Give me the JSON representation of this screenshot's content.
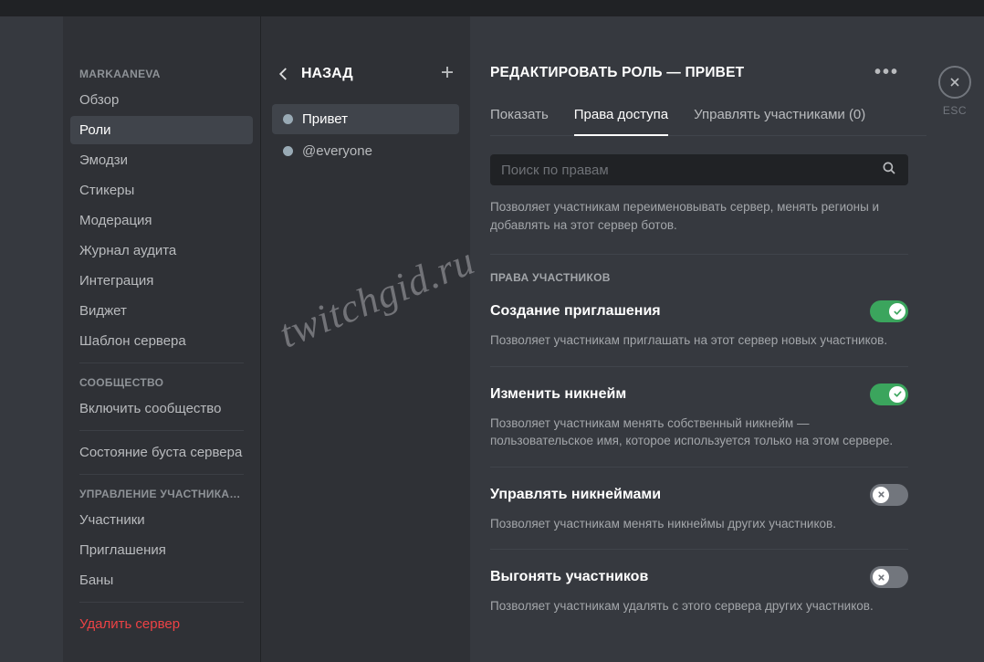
{
  "sidebar": {
    "server_name": "MARKAANEVA",
    "items_main": [
      {
        "label": "Обзор"
      },
      {
        "label": "Роли"
      },
      {
        "label": "Эмодзи"
      },
      {
        "label": "Стикеры"
      },
      {
        "label": "Модерация"
      },
      {
        "label": "Журнал аудита"
      },
      {
        "label": "Интеграция"
      },
      {
        "label": "Виджет"
      },
      {
        "label": "Шаблон сервера"
      }
    ],
    "section_community": "СООБЩЕСТВО",
    "items_community": [
      {
        "label": "Включить сообщество"
      }
    ],
    "boost_label": "Состояние буста сервера",
    "section_members": "УПРАВЛЕНИЕ УЧАСТНИКА…",
    "items_members": [
      {
        "label": "Участники"
      },
      {
        "label": "Приглашения"
      },
      {
        "label": "Баны"
      }
    ],
    "delete_label": "Удалить сервер"
  },
  "roles_col": {
    "back_label": "НАЗАД",
    "roles": [
      {
        "label": "Привет"
      },
      {
        "label": "@everyone"
      }
    ]
  },
  "main": {
    "title": "РЕДАКТИРОВАТЬ РОЛЬ — ПРИВЕТ",
    "tabs": {
      "display": "Показать",
      "permissions": "Права доступа",
      "members": "Управлять участниками (0)"
    },
    "search_placeholder": "Поиск по правам",
    "top_desc": "Позволяет участникам переименовывать сервер, менять регионы и добавлять на этот сервер ботов.",
    "section_label": "ПРАВА УЧАСТНИКОВ",
    "perms": [
      {
        "title": "Создание приглашения",
        "desc": "Позволяет участникам приглашать на этот сервер новых участников.",
        "on": true
      },
      {
        "title": "Изменить никнейм",
        "desc": "Позволяет участникам менять собственный никнейм — пользовательское имя, которое используется только на этом сервере.",
        "on": true
      },
      {
        "title": "Управлять никнеймами",
        "desc": "Позволяет участникам менять никнеймы других участников.",
        "on": false
      },
      {
        "title": "Выгонять участников",
        "desc": "Позволяет участникам удалять с этого сервера других участников.",
        "on": false
      }
    ]
  },
  "close": {
    "esc": "ESC"
  },
  "watermark": "twitchgid.ru"
}
